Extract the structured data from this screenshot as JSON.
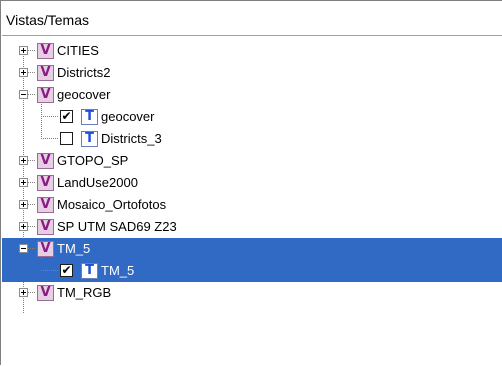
{
  "header": {
    "title": "Vistas/Temas"
  },
  "tree": {
    "views": [
      {
        "label": "CITIES",
        "icon": "view-icon",
        "expanded": false
      },
      {
        "label": "Districts2",
        "icon": "view-icon",
        "expanded": false
      },
      {
        "label": "geocover",
        "icon": "view-icon",
        "expanded": true,
        "themes": [
          {
            "label": "geocover",
            "checked": true
          },
          {
            "label": "Districts_3",
            "checked": false
          }
        ]
      },
      {
        "label": "GTOPO_SP",
        "icon": "view-icon",
        "expanded": false
      },
      {
        "label": "LandUse2000",
        "icon": "view-icon",
        "expanded": false
      },
      {
        "label": "Mosaico_Ortofotos",
        "icon": "view-icon",
        "expanded": false
      },
      {
        "label": "SP UTM SAD69 Z23",
        "icon": "view-icon",
        "expanded": false
      },
      {
        "label": "TM_5",
        "icon": "view-icon",
        "expanded": true,
        "selected": true,
        "themes": [
          {
            "label": "TM_5",
            "checked": true
          }
        ]
      },
      {
        "label": "TM_RGB",
        "icon": "view-icon",
        "expanded": false
      }
    ],
    "view_icon_glyph": "V",
    "theme_icon_glyph": "T",
    "check_glyph": "✔",
    "selection_color": "#316ac5"
  }
}
